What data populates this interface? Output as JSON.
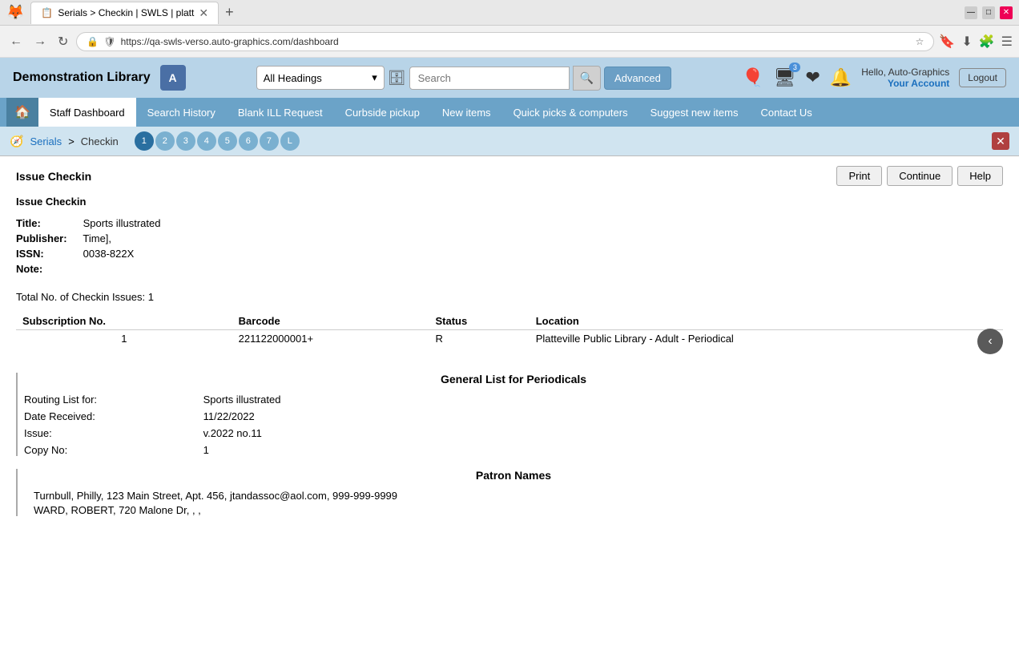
{
  "browser": {
    "tab_title": "Serials > Checkin | SWLS | platt",
    "url": "https://qa-swls-verso.auto-graphics.com/dashboard",
    "search_placeholder": "Search",
    "window_buttons": [
      "_",
      "□",
      "✕"
    ]
  },
  "header": {
    "app_title": "Demonstration Library",
    "search_dropdown_label": "All Headings",
    "advanced_label": "Advanced",
    "search_input_value": "",
    "user_hello": "Hello, Auto-Graphics",
    "user_account": "Your Account",
    "logout_label": "Logout",
    "icons": {
      "balloon": "🎈",
      "monitor": "🖥",
      "heart": "❤",
      "bell": "🔔"
    },
    "badge_count": "3"
  },
  "nav": {
    "items": [
      {
        "id": "staff-dashboard",
        "label": "Staff Dashboard",
        "active": true
      },
      {
        "id": "search-history",
        "label": "Search History"
      },
      {
        "id": "blank-ill-request",
        "label": "Blank ILL Request"
      },
      {
        "id": "curbside-pickup",
        "label": "Curbside pickup"
      },
      {
        "id": "new-items",
        "label": "New items"
      },
      {
        "id": "quick-picks",
        "label": "Quick picks & computers"
      },
      {
        "id": "suggest-new-items",
        "label": "Suggest new items"
      },
      {
        "id": "contact-us",
        "label": "Contact Us"
      }
    ]
  },
  "breadcrumb": {
    "serials_label": "Serials",
    "separator": ">",
    "checkin_label": "Checkin",
    "steps": [
      "1",
      "2",
      "3",
      "4",
      "5",
      "6",
      "7",
      "L"
    ]
  },
  "page": {
    "title": "Issue Checkin",
    "print_label": "Print",
    "continue_label": "Continue",
    "help_label": "Help",
    "issue_checkin_heading": "Issue Checkin",
    "title_label": "Title:",
    "title_value": "Sports illustrated",
    "publisher_label": "Publisher:",
    "publisher_value": "Time],",
    "issn_label": "ISSN:",
    "issn_value": "0038-822X",
    "note_label": "Note:",
    "note_value": "",
    "total_label": "Total No. of Checkin Issues:",
    "total_value": "1",
    "table_headers": {
      "subscription_no": "Subscription No.",
      "barcode": "Barcode",
      "status": "Status",
      "location": "Location"
    },
    "table_rows": [
      {
        "subscription_no": "1",
        "barcode": "221122000001+",
        "status": "R",
        "location": "Platteville Public Library - Adult - Periodical"
      }
    ],
    "general_list_heading": "General List for Periodicals",
    "routing_list_for_label": "Routing List for:",
    "routing_list_for_value": "Sports illustrated",
    "date_received_label": "Date Received:",
    "date_received_value": "11/22/2022",
    "issue_label": "Issue:",
    "issue_value": "v.2022 no.11",
    "copy_no_label": "Copy No:",
    "copy_no_value": "1",
    "patron_names_heading": "Patron Names",
    "patrons": [
      "Turnbull, Philly, 123 Main Street, Apt. 456, jtandassoc@aol.com, 999-999-9999",
      "WARD, ROBERT, 720 Malone Dr, , ,"
    ]
  }
}
